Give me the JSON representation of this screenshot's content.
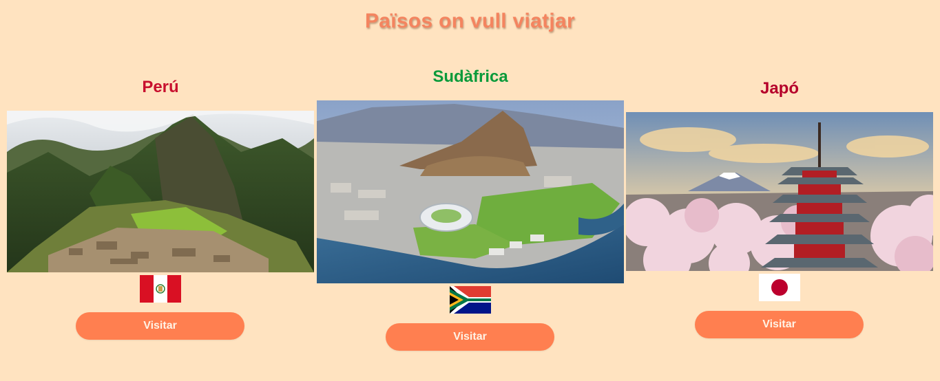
{
  "page": {
    "title": "Països on vull viatjar",
    "background": "#ffe3c0",
    "title_color": "#f4845f"
  },
  "countries": [
    {
      "name": "Perú",
      "name_color": "#c8102e",
      "photo_icon": "machu-picchu-photo",
      "flag_icon": "peru-flag-icon",
      "button_label": "Visitar"
    },
    {
      "name": "Sudàfrica",
      "name_color": "#0a9a3a",
      "photo_icon": "cape-town-photo",
      "flag_icon": "south-africa-flag-icon",
      "button_label": "Visitar"
    },
    {
      "name": "Japó",
      "name_color": "#b5002a",
      "photo_icon": "pagoda-mount-fuji-photo",
      "flag_icon": "japan-flag-icon",
      "button_label": "Visitar"
    }
  ],
  "button_color": "#ff7f50"
}
